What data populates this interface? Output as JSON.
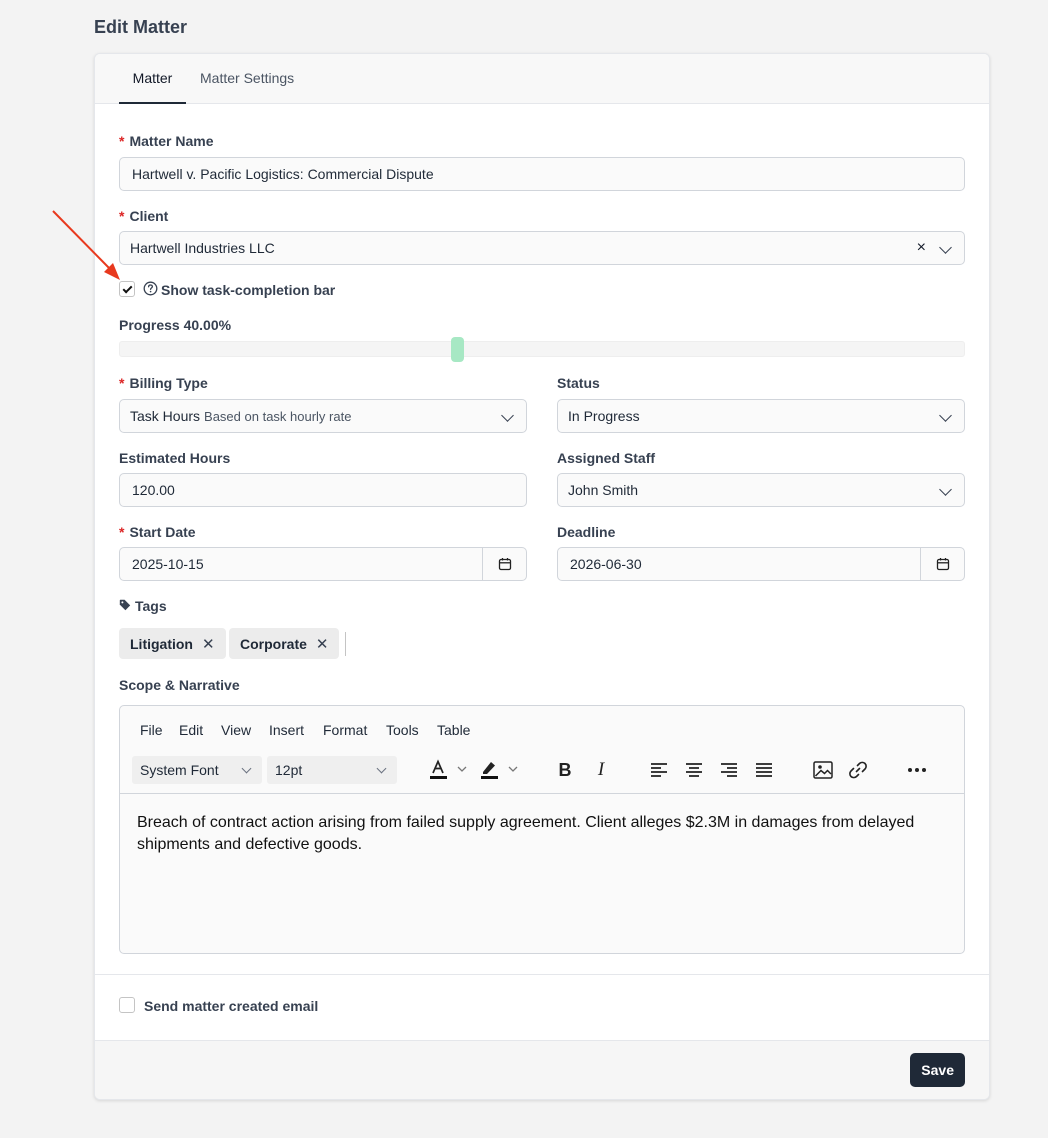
{
  "page": {
    "title": "Edit Matter"
  },
  "tabs": [
    {
      "label": "Matter",
      "active": true
    },
    {
      "label": "Matter Settings",
      "active": false
    }
  ],
  "form": {
    "matter_name": {
      "label": "Matter Name",
      "required": true,
      "value": "Hartwell v. Pacific Logistics: Commercial Dispute"
    },
    "client": {
      "label": "Client",
      "required": true,
      "value": "Hartwell Industries LLC"
    },
    "show_progress": {
      "label": "Show task-completion bar",
      "checked": true,
      "help_icon": "question-circle-icon"
    },
    "progress": {
      "label": "Progress 40.00%",
      "value": 0.4
    },
    "billing_type": {
      "label": "Billing Type",
      "required": true,
      "value": "Task Hours",
      "description": "Based on task hourly rate"
    },
    "status": {
      "label": "Status",
      "value": "In Progress"
    },
    "estimated_hours": {
      "label": "Estimated Hours",
      "value": "120.00"
    },
    "assigned_staff": {
      "label": "Assigned Staff",
      "value": "John Smith"
    },
    "start_date": {
      "label": "Start Date",
      "required": true,
      "value": "2025-10-15"
    },
    "deadline": {
      "label": "Deadline",
      "value": "2026-06-30"
    },
    "tags": {
      "label": "Tags",
      "items": [
        "Litigation",
        "Corporate"
      ]
    },
    "scope": {
      "label": "Scope & Narrative",
      "menu": [
        "File",
        "Edit",
        "View",
        "Insert",
        "Format",
        "Tools",
        "Table"
      ],
      "font_family": "System Font",
      "font_size": "12pt",
      "content": "Breach of contract action arising from failed supply agreement. Client alleges $2.3M in damages from delayed shipments and defective goods."
    },
    "send_email": {
      "label": "Send matter created email",
      "checked": false
    }
  },
  "footer": {
    "save_label": "Save"
  },
  "colors": {
    "accent": "#1f2937",
    "required": "#dc2626",
    "slider_thumb": "#a7e8c4",
    "annotation_arrow": "#e8391e"
  }
}
